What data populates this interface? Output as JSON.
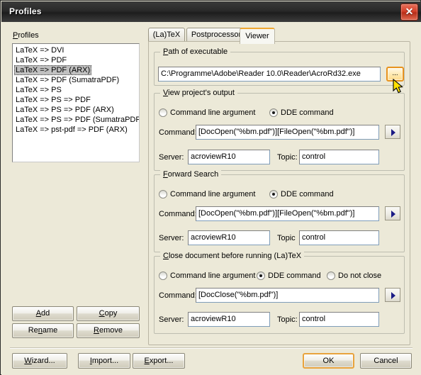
{
  "window": {
    "title": "Profiles",
    "close_label": "✕"
  },
  "left_panel": {
    "group_label": "Profiles",
    "profiles": [
      "LaTeX => DVI",
      "LaTeX => PDF",
      "LaTeX => PDF (ARX)",
      "LaTeX => PDF (SumatraPDF)",
      "LaTeX => PS",
      "LaTeX => PS => PDF",
      "LaTeX => PS => PDF (ARX)",
      "LaTeX => PS => PDF (SumatraPDF)",
      "LaTeX => pst-pdf => PDF (ARX)"
    ],
    "selected_index": 2,
    "buttons": {
      "add": "Add",
      "copy": "Copy",
      "rename": "Rename",
      "remove": "Remove"
    }
  },
  "tabs": [
    {
      "label": "(La)TeX",
      "active": false
    },
    {
      "label": "Postprocessor",
      "active": false
    },
    {
      "label": "Viewer",
      "active": true
    }
  ],
  "viewer": {
    "path_group": {
      "title": "Path of executable",
      "value": "C:\\Programme\\Adobe\\Reader 10.0\\Reader\\AcroRd32.exe",
      "browse_label": "..."
    },
    "sections": [
      {
        "title": "View project's output",
        "radios": [
          {
            "label": "Command line argument",
            "checked": false
          },
          {
            "label": "DDE command",
            "checked": true
          }
        ],
        "command_label": "Command:",
        "command_value": "[DocOpen(\"%bm.pdf\")][FileOpen(\"%bm.pdf\")]",
        "server_label": "Server:",
        "server_value": "acroviewR10",
        "topic_label": "Topic:",
        "topic_value": "control"
      },
      {
        "title": "Forward Search",
        "radios": [
          {
            "label": "Command line argument",
            "checked": false
          },
          {
            "label": "DDE command",
            "checked": true
          }
        ],
        "command_label": "Command:",
        "command_value": "[DocOpen(\"%bm.pdf\")][FileOpen(\"%bm.pdf\")]",
        "server_label": "Server:",
        "server_value": "acroviewR10",
        "topic_label": "Topic",
        "topic_value": "control"
      },
      {
        "title": "Close document before running (La)TeX",
        "radios": [
          {
            "label": "Command line argument",
            "checked": false
          },
          {
            "label": "DDE command",
            "checked": true
          },
          {
            "label": "Do not close",
            "checked": false
          }
        ],
        "command_label": "Command:",
        "command_value": "[DocClose(\"%bm.pdf\")]",
        "server_label": "Server:",
        "server_value": "acroviewR10",
        "topic_label": "Topic:",
        "topic_value": "control"
      }
    ]
  },
  "footer": {
    "wizard": "Wizard...",
    "import": "Import...",
    "export": "Export...",
    "ok": "OK",
    "cancel": "Cancel"
  },
  "colors": {
    "dialog_face": "#ece9d8",
    "accent_orange": "#e8931e",
    "close_red": "#d4412a",
    "selection_gray": "#c0c0c0",
    "arrow_blue": "#1b1b86"
  }
}
